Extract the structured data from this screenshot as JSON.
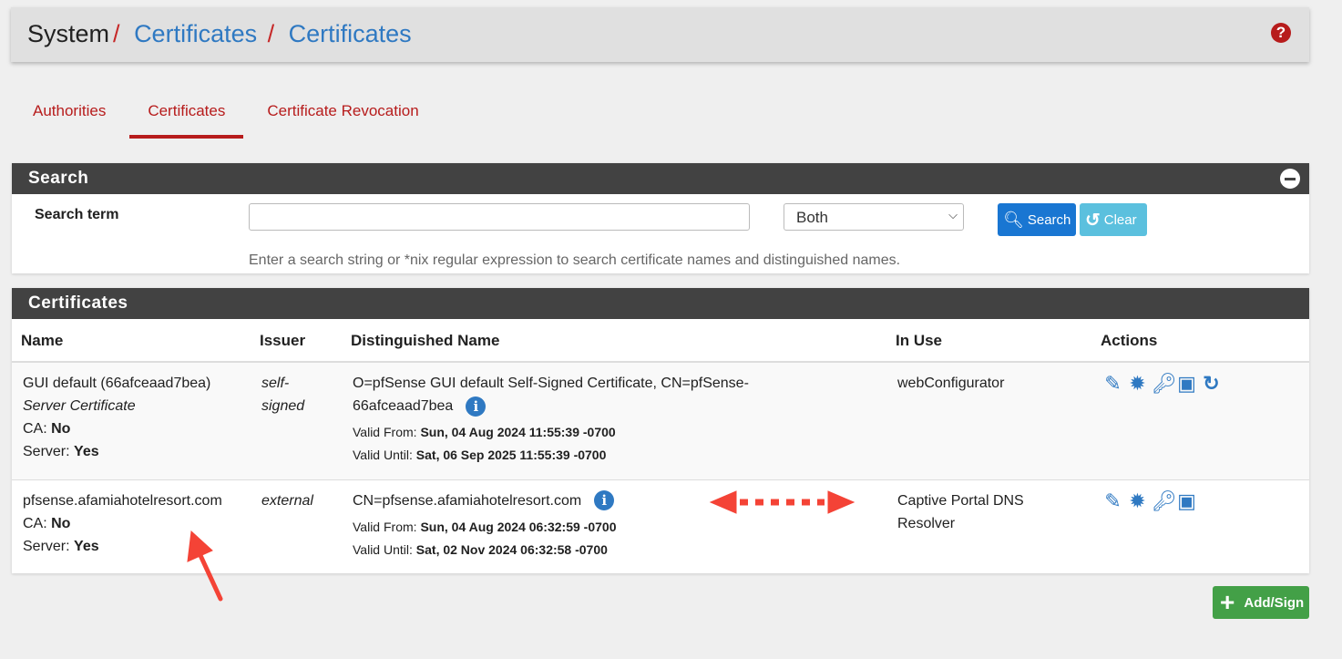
{
  "breadcrumb": [
    "System",
    "Certificates",
    "Certificates"
  ],
  "tabs": [
    "Authorities",
    "Certificates",
    "Certificate Revocation"
  ],
  "active_tab": "Certificates",
  "search": {
    "title": "Search",
    "label": "Search term",
    "value": "",
    "select": "Both",
    "search_btn": "Search",
    "clear_btn": "Clear",
    "help": "Enter a search string or *nix regular expression to search certificate names and distinguished names."
  },
  "certs": {
    "title": "Certificates",
    "columns": [
      "Name",
      "Issuer",
      "Distinguished Name",
      "In Use",
      "Actions"
    ],
    "rows": [
      {
        "name": "GUI default (66afceaad7bea)",
        "type": "Server Certificate",
        "ca_label": "CA:",
        "ca": "No",
        "server_label": "Server:",
        "server": "Yes",
        "issuer": "self-signed",
        "dn": "O=pfSense GUI default Self-Signed Certificate, CN=pfSense-66afceaad7bea",
        "from_label": "Valid From:",
        "from": "Sun, 04 Aug 2024 11:55:39 -0700",
        "until_label": "Valid Until:",
        "until": "Sat, 06 Sep 2025 11:55:39 -0700",
        "in_use": "webConfigurator"
      },
      {
        "name": "pfsense.afamiahotelresort.com",
        "ca_label": "CA:",
        "ca": "No",
        "server_label": "Server:",
        "server": "Yes",
        "issuer": "external",
        "dn": "CN=pfsense.afamiahotelresort.com",
        "from_label": "Valid From:",
        "from": "Sun, 04 Aug 2024 06:32:59 -0700",
        "until_label": "Valid Until:",
        "until": "Sat, 02 Nov 2024 06:32:58 -0700",
        "in_use": "Captive Portal DNS Resolver"
      }
    ]
  },
  "add_btn": "Add/Sign",
  "colors": {
    "accent": "#b71c1c",
    "link": "#2f79c2",
    "panel_header": "#424242",
    "add": "#43a047",
    "annotation": "#f44336"
  }
}
